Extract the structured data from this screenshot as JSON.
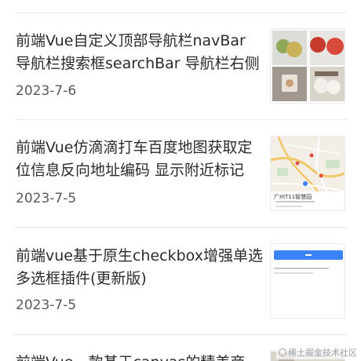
{
  "articles": [
    {
      "title": "前端Vue自定义顶部导航栏navBar 导航栏搜索框searchBar 导航栏右侧",
      "date": "2023-7-6"
    },
    {
      "title": "前端Vue仿滴滴打车百度地图获取定位信息反向地址编码 显示附近标记",
      "date": "2023-7-5",
      "thumb_caption": "广州T11智慧园"
    },
    {
      "title": "前端vue基于原生checkbox增强单选多选框插件(更新版)",
      "date": "2023-7-5"
    },
    {
      "title": "前端Vue一款基于canvas的精美商"
    }
  ],
  "watermark": "稀土掘金技术社区",
  "colors": {
    "title": "#2b2b2b",
    "date": "#555a60",
    "divider": "#e8e8ea",
    "accent_blue": "#3b82f6"
  }
}
